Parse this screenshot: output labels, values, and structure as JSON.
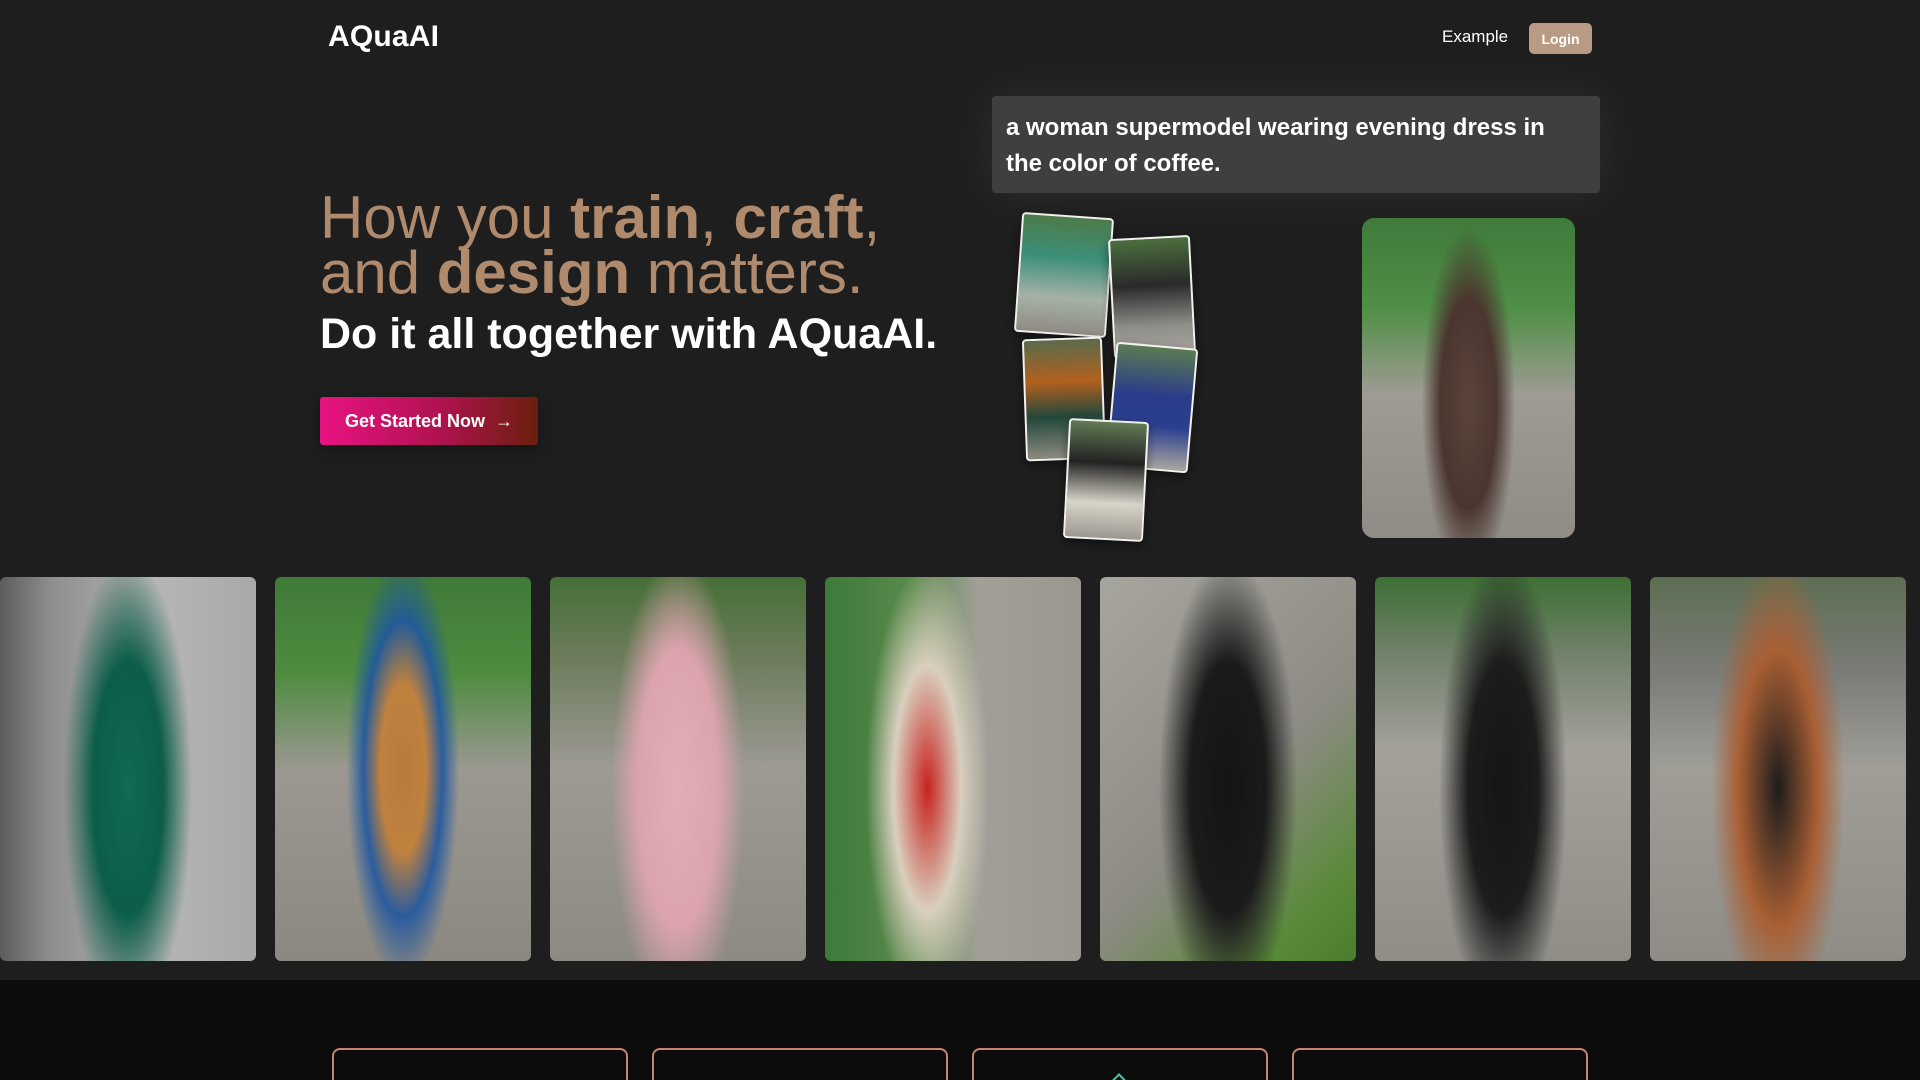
{
  "header": {
    "logo": "AQuaAI",
    "nav_example": "Example",
    "login_label": "Login"
  },
  "hero": {
    "line1_a": "How you ",
    "line1_b": "train",
    "line1_c": ", ",
    "line1_d": "craft",
    "line1_e": ",",
    "line2_a": "and ",
    "line2_b": "design",
    "line2_c": " matters.",
    "sub_a": "Do it ",
    "sub_b": "all together",
    "sub_c": " with ",
    "sub_d": "AQuaAI",
    "sub_e": ".",
    "cta_label": "Get Started Now",
    "cta_icon": "arrow-right-icon"
  },
  "demo": {
    "prompt_text": "a woman supermodel wearing evening dress in the color of coffee."
  },
  "colors": {
    "background": "#1e1e1e",
    "hero_accent": "#b08a6d",
    "login_bg": "#b99a85",
    "cta_gradient_start": "#e81382",
    "cta_gradient_end": "#6a1f0c",
    "card_border": "#c48670"
  }
}
